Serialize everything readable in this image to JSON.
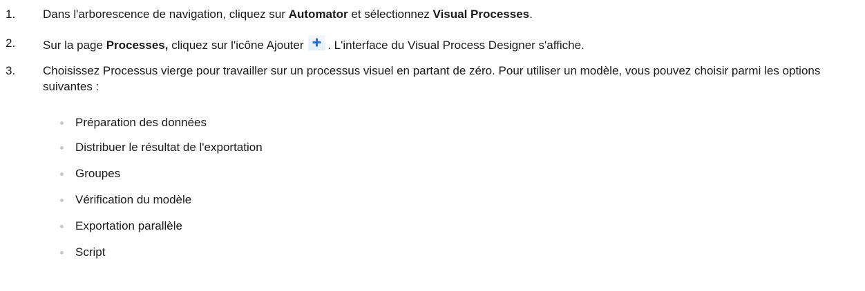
{
  "steps": [
    {
      "number": "1.",
      "parts": [
        "Dans l'arborescence de navigation, cliquez sur ",
        "Automator",
        " et sélectionnez ",
        "Visual Processes",
        "."
      ]
    },
    {
      "number": "2.",
      "parts": [
        "Sur la page ",
        "Processes,",
        " cliquez sur l'icône Ajouter ",
        ". L'interface du Visual Process Designer s'affiche."
      ],
      "icon": "add-plus-icon"
    },
    {
      "number": "3.",
      "parts": [
        "Choisissez Processus vierge pour travailler sur un processus visuel en partant de zéro. Pour utiliser un modèle, vous pouvez choisir parmi les options suivantes :"
      ]
    }
  ],
  "options": [
    "Préparation des données",
    "Distribuer le résultat de l'exportation",
    "Groupes",
    "Vérification du modèle",
    "Exportation parallèle",
    "Script"
  ],
  "colors": {
    "text": "#1a1a1a",
    "bullet": "#c8c8c8",
    "icon_plus": "#1f73c4",
    "icon_bg": "#e4edf7"
  }
}
